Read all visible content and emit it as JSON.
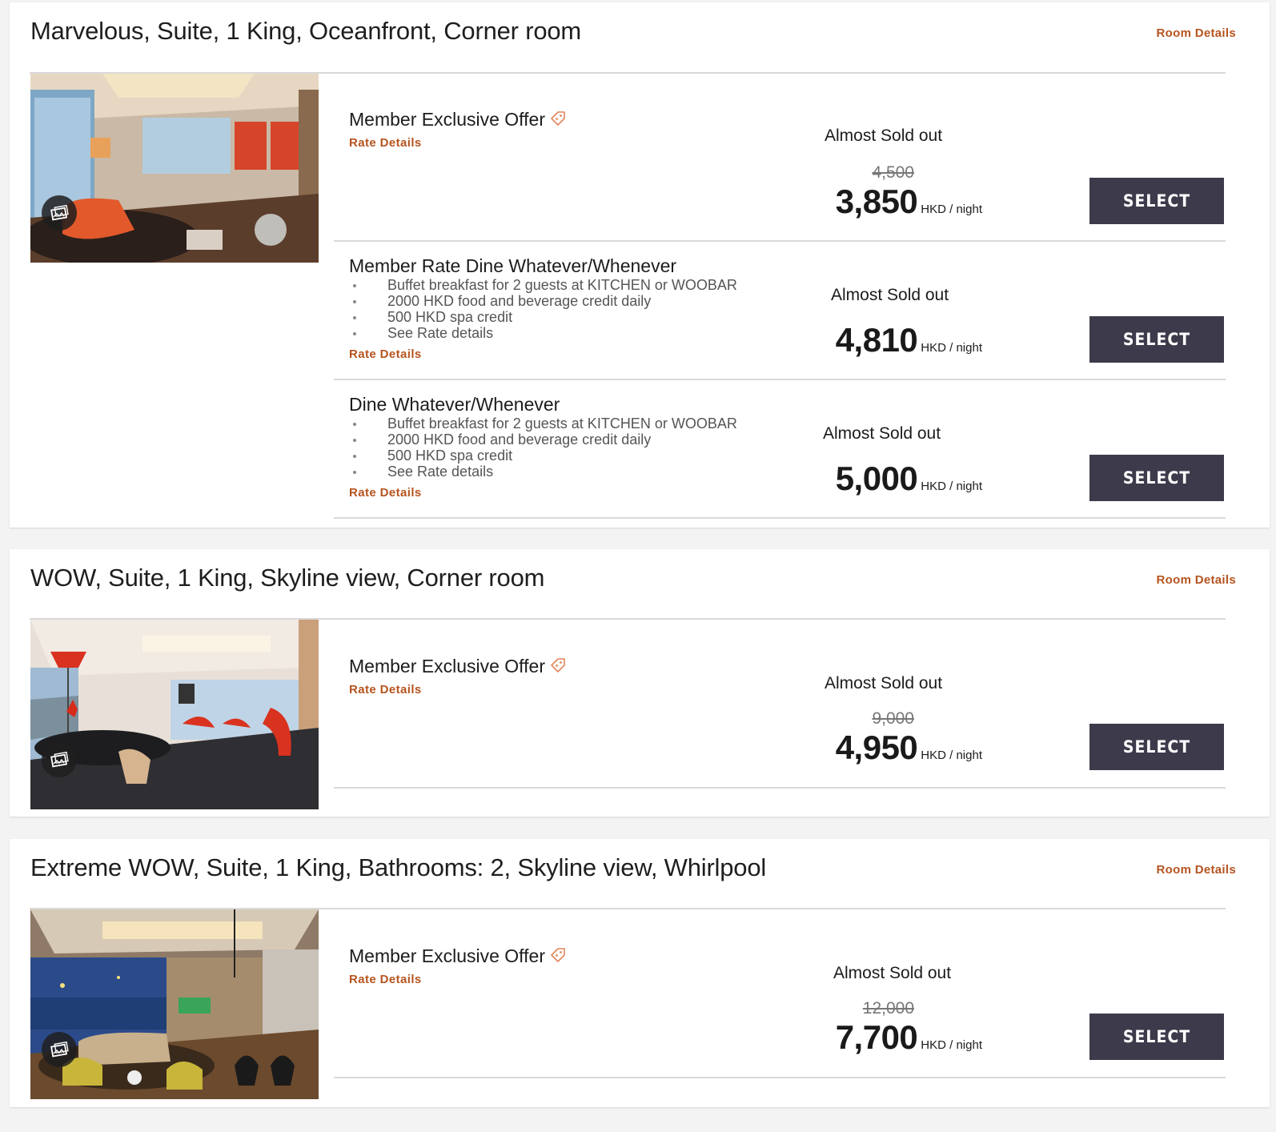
{
  "icons": {
    "tag": "tag-icon",
    "gallery": "gallery-icon"
  },
  "colors": {
    "link": "#b5541f",
    "button": "#3d3a4b",
    "tag": "#e3865b"
  },
  "rooms": [
    {
      "title": "Marvelous, Suite, 1 King, Oceanfront, Corner room",
      "room_details": "Room Details",
      "rates": [
        {
          "name": "Member Exclusive Offer",
          "tag": true,
          "link": "Rate Details",
          "inclusions": [],
          "availability": "Almost Sold out",
          "old_price": "4,500",
          "price": "3,850",
          "unit": "HKD / night",
          "button": "SELECT"
        },
        {
          "name": "Member Rate Dine Whatever/Whenever",
          "tag": false,
          "link": "Rate Details",
          "inclusions": [
            "Buffet breakfast for 2 guests at KITCHEN or WOOBAR",
            "2000 HKD food and beverage credit daily",
            "500 HKD spa credit",
            "See Rate details"
          ],
          "availability": "Almost Sold out",
          "old_price": "",
          "price": "4,810",
          "unit": "HKD / night",
          "button": "SELECT"
        },
        {
          "name": "Dine Whatever/Whenever",
          "tag": false,
          "link": "Rate Details",
          "inclusions": [
            "Buffet breakfast for 2 guests at KITCHEN or WOOBAR",
            "2000 HKD food and beverage credit daily",
            "500 HKD spa credit",
            "See Rate details"
          ],
          "availability": "Almost Sold out",
          "old_price": "",
          "price": "5,000",
          "unit": "HKD / night",
          "button": "SELECT"
        }
      ]
    },
    {
      "title": "WOW, Suite, 1 King, Skyline view, Corner room",
      "room_details": "Room Details",
      "rates": [
        {
          "name": "Member Exclusive Offer",
          "tag": true,
          "link": "Rate Details",
          "inclusions": [],
          "availability": "Almost Sold out",
          "old_price": "9,000",
          "price": "4,950",
          "unit": "HKD / night",
          "button": "SELECT"
        }
      ]
    },
    {
      "title": "Extreme WOW, Suite, 1 King, Bathrooms: 2, Skyline view, Whirlpool",
      "room_details": "Room Details",
      "rates": [
        {
          "name": "Member Exclusive Offer",
          "tag": true,
          "link": "Rate Details",
          "inclusions": [],
          "availability": "Almost Sold out",
          "old_price": "12,000",
          "price": "7,700",
          "unit": "HKD / night",
          "button": "SELECT"
        }
      ]
    }
  ]
}
